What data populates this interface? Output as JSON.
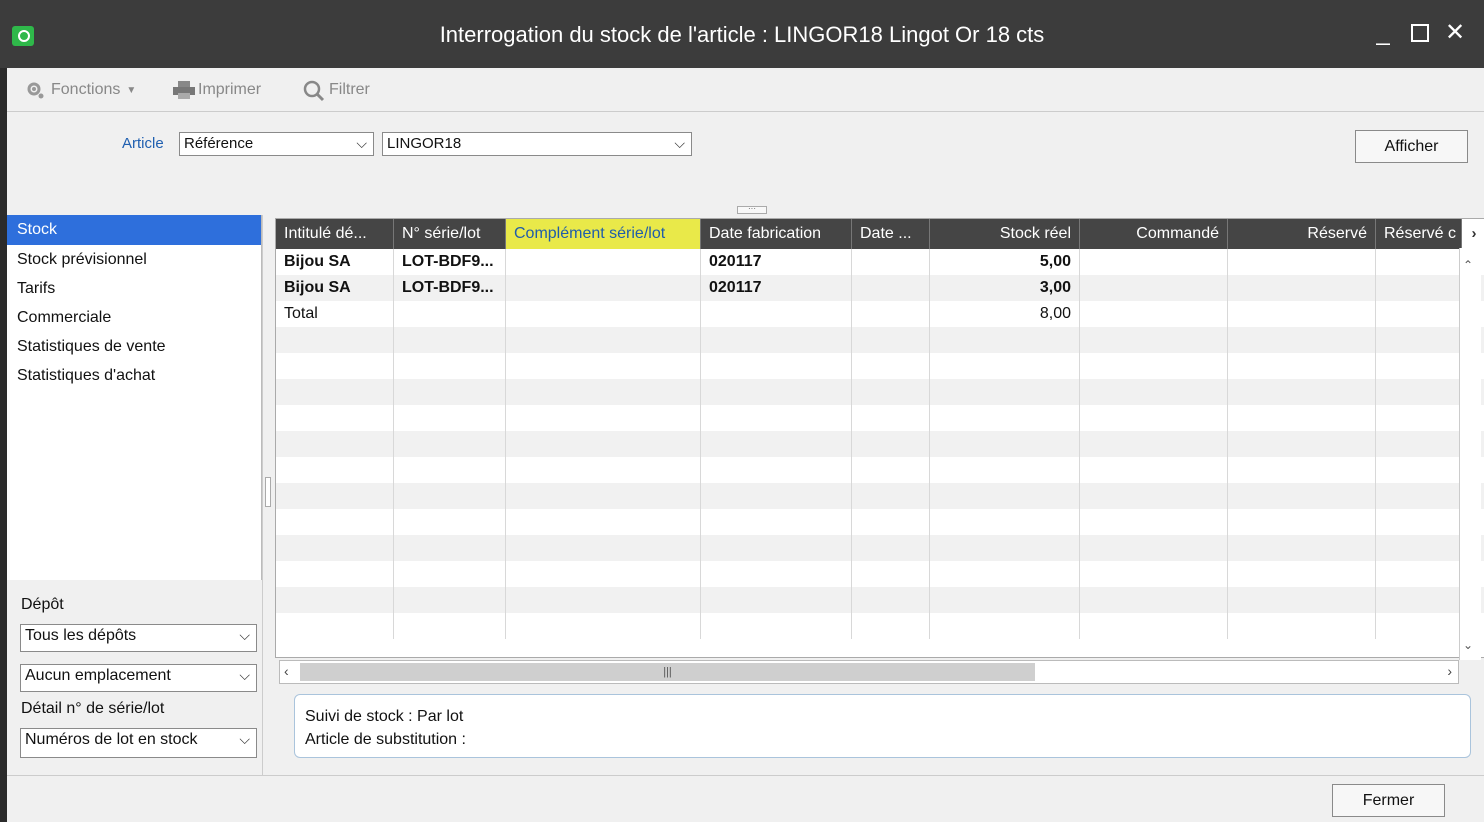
{
  "window": {
    "title": "Interrogation du stock de l'article : LINGOR18 Lingot Or 18 cts",
    "minimize": "_",
    "maximize": "☐",
    "close": "✕"
  },
  "toolbar": {
    "functions_label": "Fonctions",
    "print_label": "Imprimer",
    "filter_label": "Filtrer"
  },
  "selection": {
    "article_label": "Article",
    "type_value": "Référence",
    "code_value": "LINGOR18",
    "show_button": "Afficher"
  },
  "nav": {
    "items": [
      {
        "label": "Stock",
        "active": true
      },
      {
        "label": "Stock prévisionnel"
      },
      {
        "label": "Tarifs"
      },
      {
        "label": "Commerciale"
      },
      {
        "label": "Statistiques de vente"
      },
      {
        "label": "Statistiques d'achat"
      }
    ]
  },
  "filters": {
    "depot_label": "Dépôt",
    "depot_value": "Tous les dépôts",
    "location_value": "Aucun emplacement",
    "serial_detail_label": "Détail n° de série/lot",
    "serial_detail_value": "Numéros de lot en stock"
  },
  "grid": {
    "columns": [
      "Intitulé dé...",
      "N° série/lot",
      "Complément série/lot",
      "Date fabrication",
      "Date ...",
      "Stock réel",
      "Commandé",
      "Réservé",
      "Réservé c"
    ],
    "rows": [
      [
        "Bijou SA",
        "LOT-BDF9...",
        "",
        "020117",
        "",
        "5,00",
        "",
        "",
        ""
      ],
      [
        "Bijou SA",
        "LOT-BDF9...",
        "",
        "020117",
        "",
        "3,00",
        "",
        "",
        ""
      ],
      [
        "Total",
        "",
        "",
        "",
        "",
        "8,00",
        "",
        "",
        ""
      ]
    ]
  },
  "info": {
    "line1": "Suivi de stock : Par lot",
    "line2": "Article de substitution :"
  },
  "footer": {
    "close_button": "Fermer"
  }
}
